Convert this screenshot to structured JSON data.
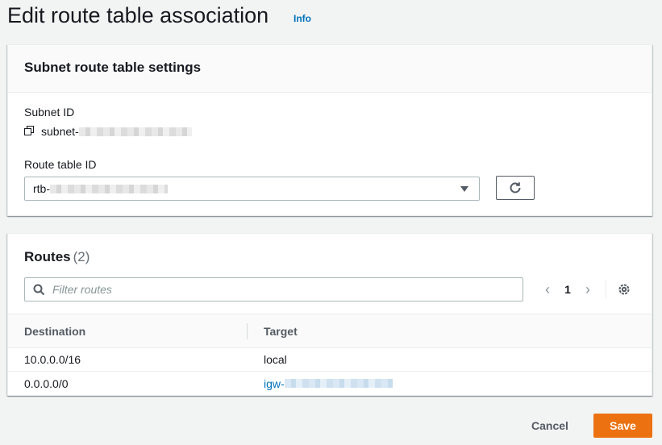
{
  "page": {
    "title": "Edit route table association",
    "info_label": "Info"
  },
  "settings": {
    "header": "Subnet route table settings",
    "subnet_label": "Subnet ID",
    "subnet_prefix": "subnet-",
    "route_table_label": "Route table ID",
    "route_table_prefix": "rtb-"
  },
  "routes": {
    "title": "Routes",
    "count": "(2)",
    "filter_placeholder": "Filter routes",
    "current_page": "1",
    "columns": [
      "Destination",
      "Target"
    ],
    "rows": [
      {
        "destination": "10.0.0.0/16",
        "target": "local",
        "target_is_link": false
      },
      {
        "destination": "0.0.0.0/0",
        "target": "igw-",
        "target_is_link": true
      }
    ]
  },
  "actions": {
    "cancel_label": "Cancel",
    "save_label": "Save"
  },
  "colors": {
    "accent": "#ec7211",
    "link": "#0073bb"
  },
  "icons": [
    "copy-icon",
    "caret-down-icon",
    "refresh-icon",
    "search-icon",
    "chevron-left-icon",
    "chevron-right-icon",
    "gear-icon"
  ]
}
